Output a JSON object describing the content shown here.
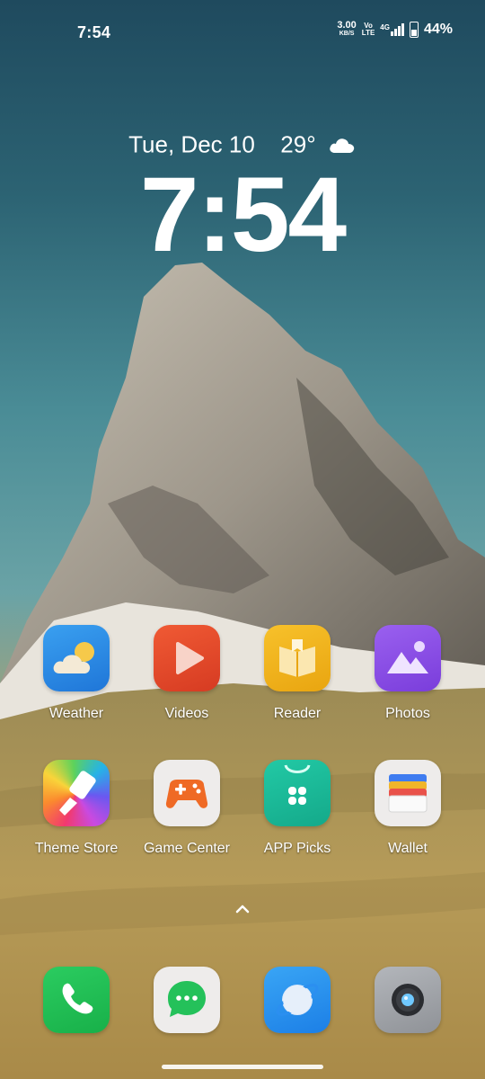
{
  "status_bar": {
    "time": "7:54",
    "net_speed_value": "3.00",
    "net_speed_unit": "KB/S",
    "volte_top": "Vo",
    "volte_bottom": "LTE",
    "network": "4G",
    "battery_percent": "44%",
    "battery_level": 0.44
  },
  "lockscreen": {
    "date": "Tue, Dec 10",
    "temperature": "29°",
    "weather_icon": "cloud-icon",
    "clock": "7:54"
  },
  "apps_row1": [
    {
      "name": "Weather",
      "icon": "weather-icon"
    },
    {
      "name": "Videos",
      "icon": "play-icon"
    },
    {
      "name": "Reader",
      "icon": "book-icon"
    },
    {
      "name": "Photos",
      "icon": "photos-icon"
    }
  ],
  "apps_row2": [
    {
      "name": "Theme Store",
      "icon": "brush-icon"
    },
    {
      "name": "Game Center",
      "icon": "gamepad-icon"
    },
    {
      "name": "APP Picks",
      "icon": "shopping-bag-icon"
    },
    {
      "name": "Wallet",
      "icon": "wallet-icon"
    }
  ],
  "dock": [
    {
      "name": "Phone",
      "icon": "phone-icon"
    },
    {
      "name": "Messages",
      "icon": "chat-icon"
    },
    {
      "name": "Browser",
      "icon": "planet-icon"
    },
    {
      "name": "Camera",
      "icon": "camera-icon"
    }
  ],
  "colors": {
    "weather": "#2f8ee8",
    "videos": "#e74a2c",
    "reader": "#f1b21a",
    "photos": "#8d4fe6",
    "game_accent": "#ef6a25",
    "app_picks": "#1bbc9b",
    "phone": "#1fbf55",
    "messages": "#24c15a",
    "browser": "#2b8ff0"
  }
}
